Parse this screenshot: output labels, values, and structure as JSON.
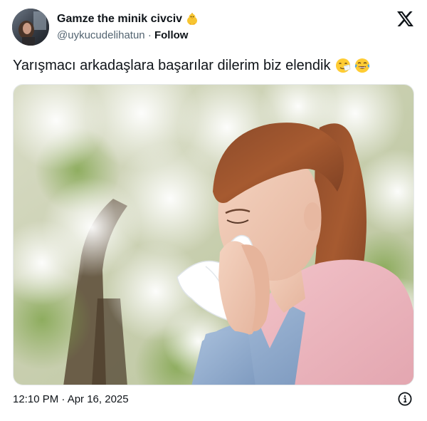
{
  "author": {
    "display_name": "Gamze the minik civciv",
    "name_emoji": "chick-emoji",
    "handle": "@uykucudelihatun",
    "separator": "·",
    "follow_label": "Follow"
  },
  "tweet": {
    "text": "Yarışmacı arkadaşlara başarılar dilerim biz elendik",
    "emojis": [
      "sneezing-face-emoji",
      "face-with-tears-of-joy-emoji"
    ],
    "timestamp": "12:10 PM · Apr 16, 2025"
  },
  "icons": {
    "brand": "x-logo-icon",
    "info": "info-icon"
  },
  "colors": {
    "text_primary": "#0f1419",
    "text_secondary": "#536471",
    "background": "#ffffff"
  }
}
